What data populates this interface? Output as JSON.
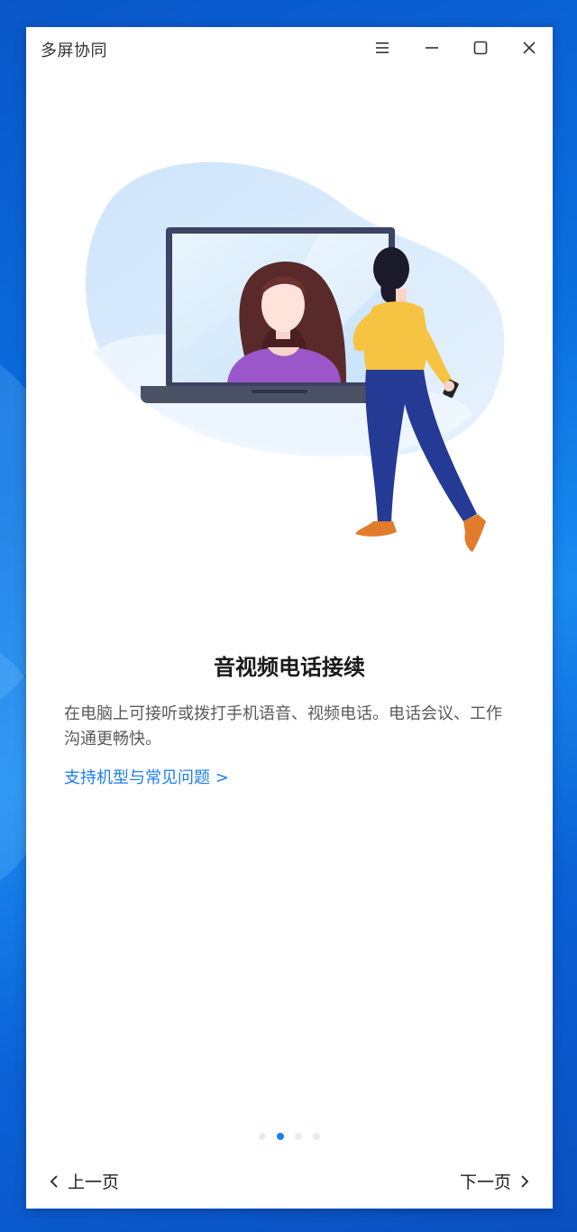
{
  "window": {
    "title": "多屏协同",
    "controls": [
      "menu-icon",
      "minimize-icon",
      "maximize-icon",
      "close-icon"
    ]
  },
  "slide": {
    "heading": "音视频电话接续",
    "description": "在电脑上可接听或拨打手机语音、视频电话。电话会议、工作沟通更畅快。",
    "link": "支持机型与常见问题 >"
  },
  "pager": {
    "total": 4,
    "active_index": 1
  },
  "navigation": {
    "prev_label": "上一页",
    "next_label": "下一页"
  },
  "colors": {
    "accent": "#1b7ff0",
    "desktop": "#0b6fe0",
    "blob": "#d3e8fb"
  }
}
